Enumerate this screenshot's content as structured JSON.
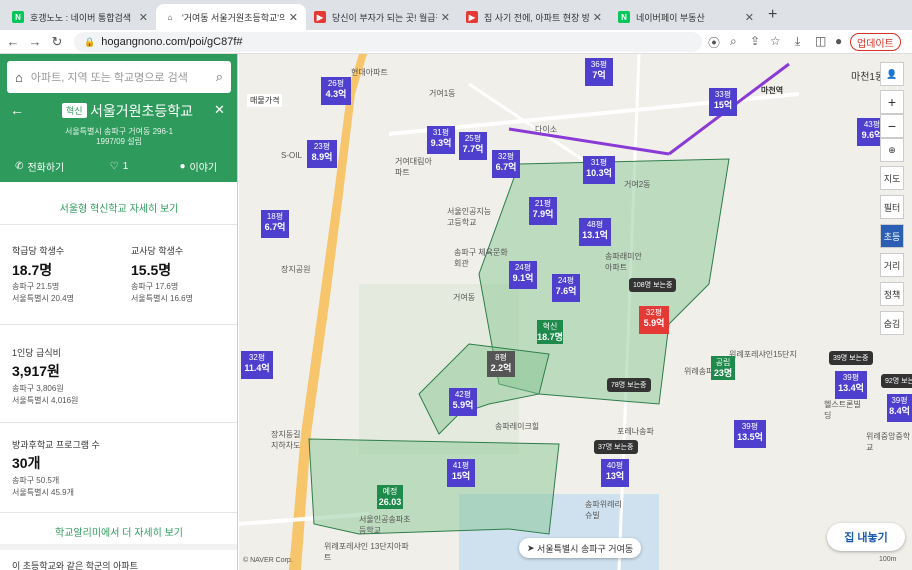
{
  "browser": {
    "tabs": [
      {
        "title": "호갱노노 : 네이버 통합검색",
        "fav": "N",
        "color": "#03c75a"
      },
      {
        "title": "'거여동 서울거원초등학교'의 혁신초",
        "fav": "⌂",
        "color": "#555"
      },
      {
        "title": "당신이 부자가 되는 곳! 월급쟁이부자",
        "fav": "▶",
        "color": "#e53935"
      },
      {
        "title": "집 사기 전에, 아파트 현장 방문 꿀팁",
        "fav": "▶",
        "color": "#e53935"
      },
      {
        "title": "네이버페이 부동산",
        "fav": "N",
        "color": "#03c75a"
      }
    ],
    "url": "hogangnono.com/poi/gC87f#",
    "update_label": "업데이트"
  },
  "panel": {
    "search_placeholder": "아파트, 지역 또는 학교명으로 검색",
    "badge": "혁신",
    "school_name": "서울거원초등학교",
    "address": "서울특별시 송파구 거여동 296-1",
    "founded": "1997/09 설립",
    "actions": {
      "call": "전화하기",
      "like": "1",
      "talk": "이야기"
    },
    "innovation_link": "서울형 혁신학교 자세히 보기",
    "stats": [
      {
        "title": "학급당 학생수",
        "value": "18.7명",
        "l1": "송파구 21.5명",
        "l2": "서울특별시 20.4명"
      },
      {
        "title": "교사당 학생수",
        "value": "15.5명",
        "l1": "송파구 17.6명",
        "l2": "서울특별시 16.6명"
      }
    ],
    "meal": {
      "title": "1인당 급식비",
      "value": "3,917원",
      "l1": "송파구 3,806원",
      "l2": "서울특별시 4,016원"
    },
    "after": {
      "title": "방과후학교 프로그램 수",
      "value": "30개",
      "l1": "송파구 50.5개",
      "l2": "서울특별시 45.9개"
    },
    "alimi_link": "학교알리미에서 더 자세히 보기",
    "footer": "이 초등학교와 같은 학군의 아파트"
  },
  "map": {
    "labels": [
      "거여1동",
      "거여2동",
      "거여동",
      "마천1동",
      "마천역",
      "다이소",
      "송파구 체육문화회관",
      "장지공원",
      "S-OIL",
      "현대아파트",
      "위례포레샤인15단지",
      "위례송파꿈",
      "서울인공지능고등학교",
      "송파레이크힐",
      "포레나송파",
      "송파위례리슈빌",
      "헬스트론빌딩",
      "위례중앙중학교",
      "장지동길 지하차도",
      "위례포레샤인 13단지아파트",
      "서울인공송파초등학교",
      "거여대림아파트",
      "송파래미안아파트"
    ],
    "markers": [
      {
        "top": "36평",
        "val": "7억"
      },
      {
        "top": "33평",
        "val": "15억"
      },
      {
        "top": "26평",
        "val": "4.3억"
      },
      {
        "top": "23평",
        "val": "8.9억"
      },
      {
        "top": "31평",
        "val": "9.3억"
      },
      {
        "top": "25평",
        "val": "7.7억"
      },
      {
        "top": "32평",
        "val": "6.7억"
      },
      {
        "top": "31평",
        "val": "10.3억"
      },
      {
        "top": "21평",
        "val": "7.9억"
      },
      {
        "top": "48평",
        "val": "13.1억"
      },
      {
        "top": "24평",
        "val": "9.1억"
      },
      {
        "top": "24평",
        "val": "7.6억"
      },
      {
        "top": "18평",
        "val": "6.7억"
      },
      {
        "top": "32평",
        "val": "11.4억"
      },
      {
        "top": "32평",
        "val": "5.9억"
      },
      {
        "top": "42평",
        "val": "5.9억"
      },
      {
        "top": "41평",
        "val": "15억"
      },
      {
        "top": "40평",
        "val": "13억"
      },
      {
        "top": "39평",
        "val": "13.4억"
      },
      {
        "top": "39평",
        "val": "13.5억"
      },
      {
        "top": "43평",
        "val": "9.6억"
      },
      {
        "top": "39평",
        "val": "8.4억"
      },
      {
        "top": "8평",
        "val": "2.2억"
      }
    ],
    "counts": [
      "108명 보는중",
      "78명 보는중",
      "37명 보는중",
      "39명 보는중",
      "92명 보는중"
    ],
    "school_pin": {
      "tag": "혁신",
      "val": "18.7명"
    },
    "pin_other": {
      "tag": "예정",
      "val": "26.03"
    },
    "pin_other2": {
      "tag": "공립",
      "val": "23명"
    },
    "price_lbl": "매물가격",
    "right_buttons": [
      "지도",
      "필터",
      "초등",
      "거리",
      "정책",
      "숨김"
    ],
    "house_btn": "집 내놓기",
    "location": "서울특별시 송파구 거여동",
    "copyright": "© NAVER Corp.",
    "scale": "100m"
  }
}
